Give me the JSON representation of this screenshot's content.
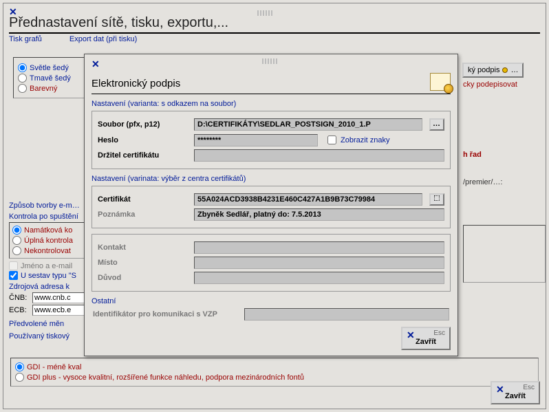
{
  "main": {
    "title": "Přednastavení sítě, tisku, exportu,...",
    "tabs": [
      "Tisk grafů",
      "Export dat (při tisku)"
    ],
    "shade_options": [
      "Světle šedý",
      "Tmavě šedý",
      "Barevný"
    ],
    "way_email": "Způsob tvorby e-m…",
    "check_after_start": "Kontrola po spuštění",
    "check_opts": [
      "Namátková ko",
      "Úplná kontrola",
      "Nekontrolovat"
    ],
    "name_email": "Jméno a e-mail",
    "sestavy": "U sestav typu \"S",
    "src_addr": "Zdrojová adresa k",
    "cnb": {
      "label": "ČNB:",
      "value": "www.cnb.c"
    },
    "ecb": {
      "label": "ECB:",
      "value": "www.ecb.e"
    },
    "pref_currency": "Předvolené měn",
    "print_mode": "Používaný tiskový",
    "gdi1": "GDI - méně kval",
    "gdi2": "GDI plus - vysoce kvalitní, rozšířené funkce náhledu, podpora mezinárodních fontů",
    "close": "Zavřít",
    "right_btn": "ký podpis",
    "right_sign": "cky podepisovat",
    "right_series": "h řad",
    "right_premier": "/premier/…:"
  },
  "dialog": {
    "title": "Elektronický podpis",
    "sect1": "Nastavení (varianta: s odkazem na soubor)",
    "file_label": "Soubor (pfx, p12)",
    "file_value": "D:\\CERTIFIKÁTY\\SEDLAR_POSTSIGN_2010_1.P",
    "pw_label": "Heslo",
    "pw_value": "********",
    "show_chars": "Zobrazit znaky",
    "holder_label": "Držitel certifikátu",
    "holder_value": "",
    "sect2": "Nastavení (varinata: výběr z centra certifikátů)",
    "cert_label": "Certifikát",
    "cert_value": "55A024ACD3938B4231E460C427A1B9B73C79984",
    "note_label": "Poznámka",
    "note_value": "Zbyněk Sedlář, platný do: 7.5.2013",
    "contact_label": "Kontakt",
    "place_label": "Místo",
    "reason_label": "Důvod",
    "sect3": "Ostatní",
    "vzp_label": "Identifikátor pro komunikaci s VZP",
    "close": "Zavřít",
    "esc": "Esc"
  }
}
